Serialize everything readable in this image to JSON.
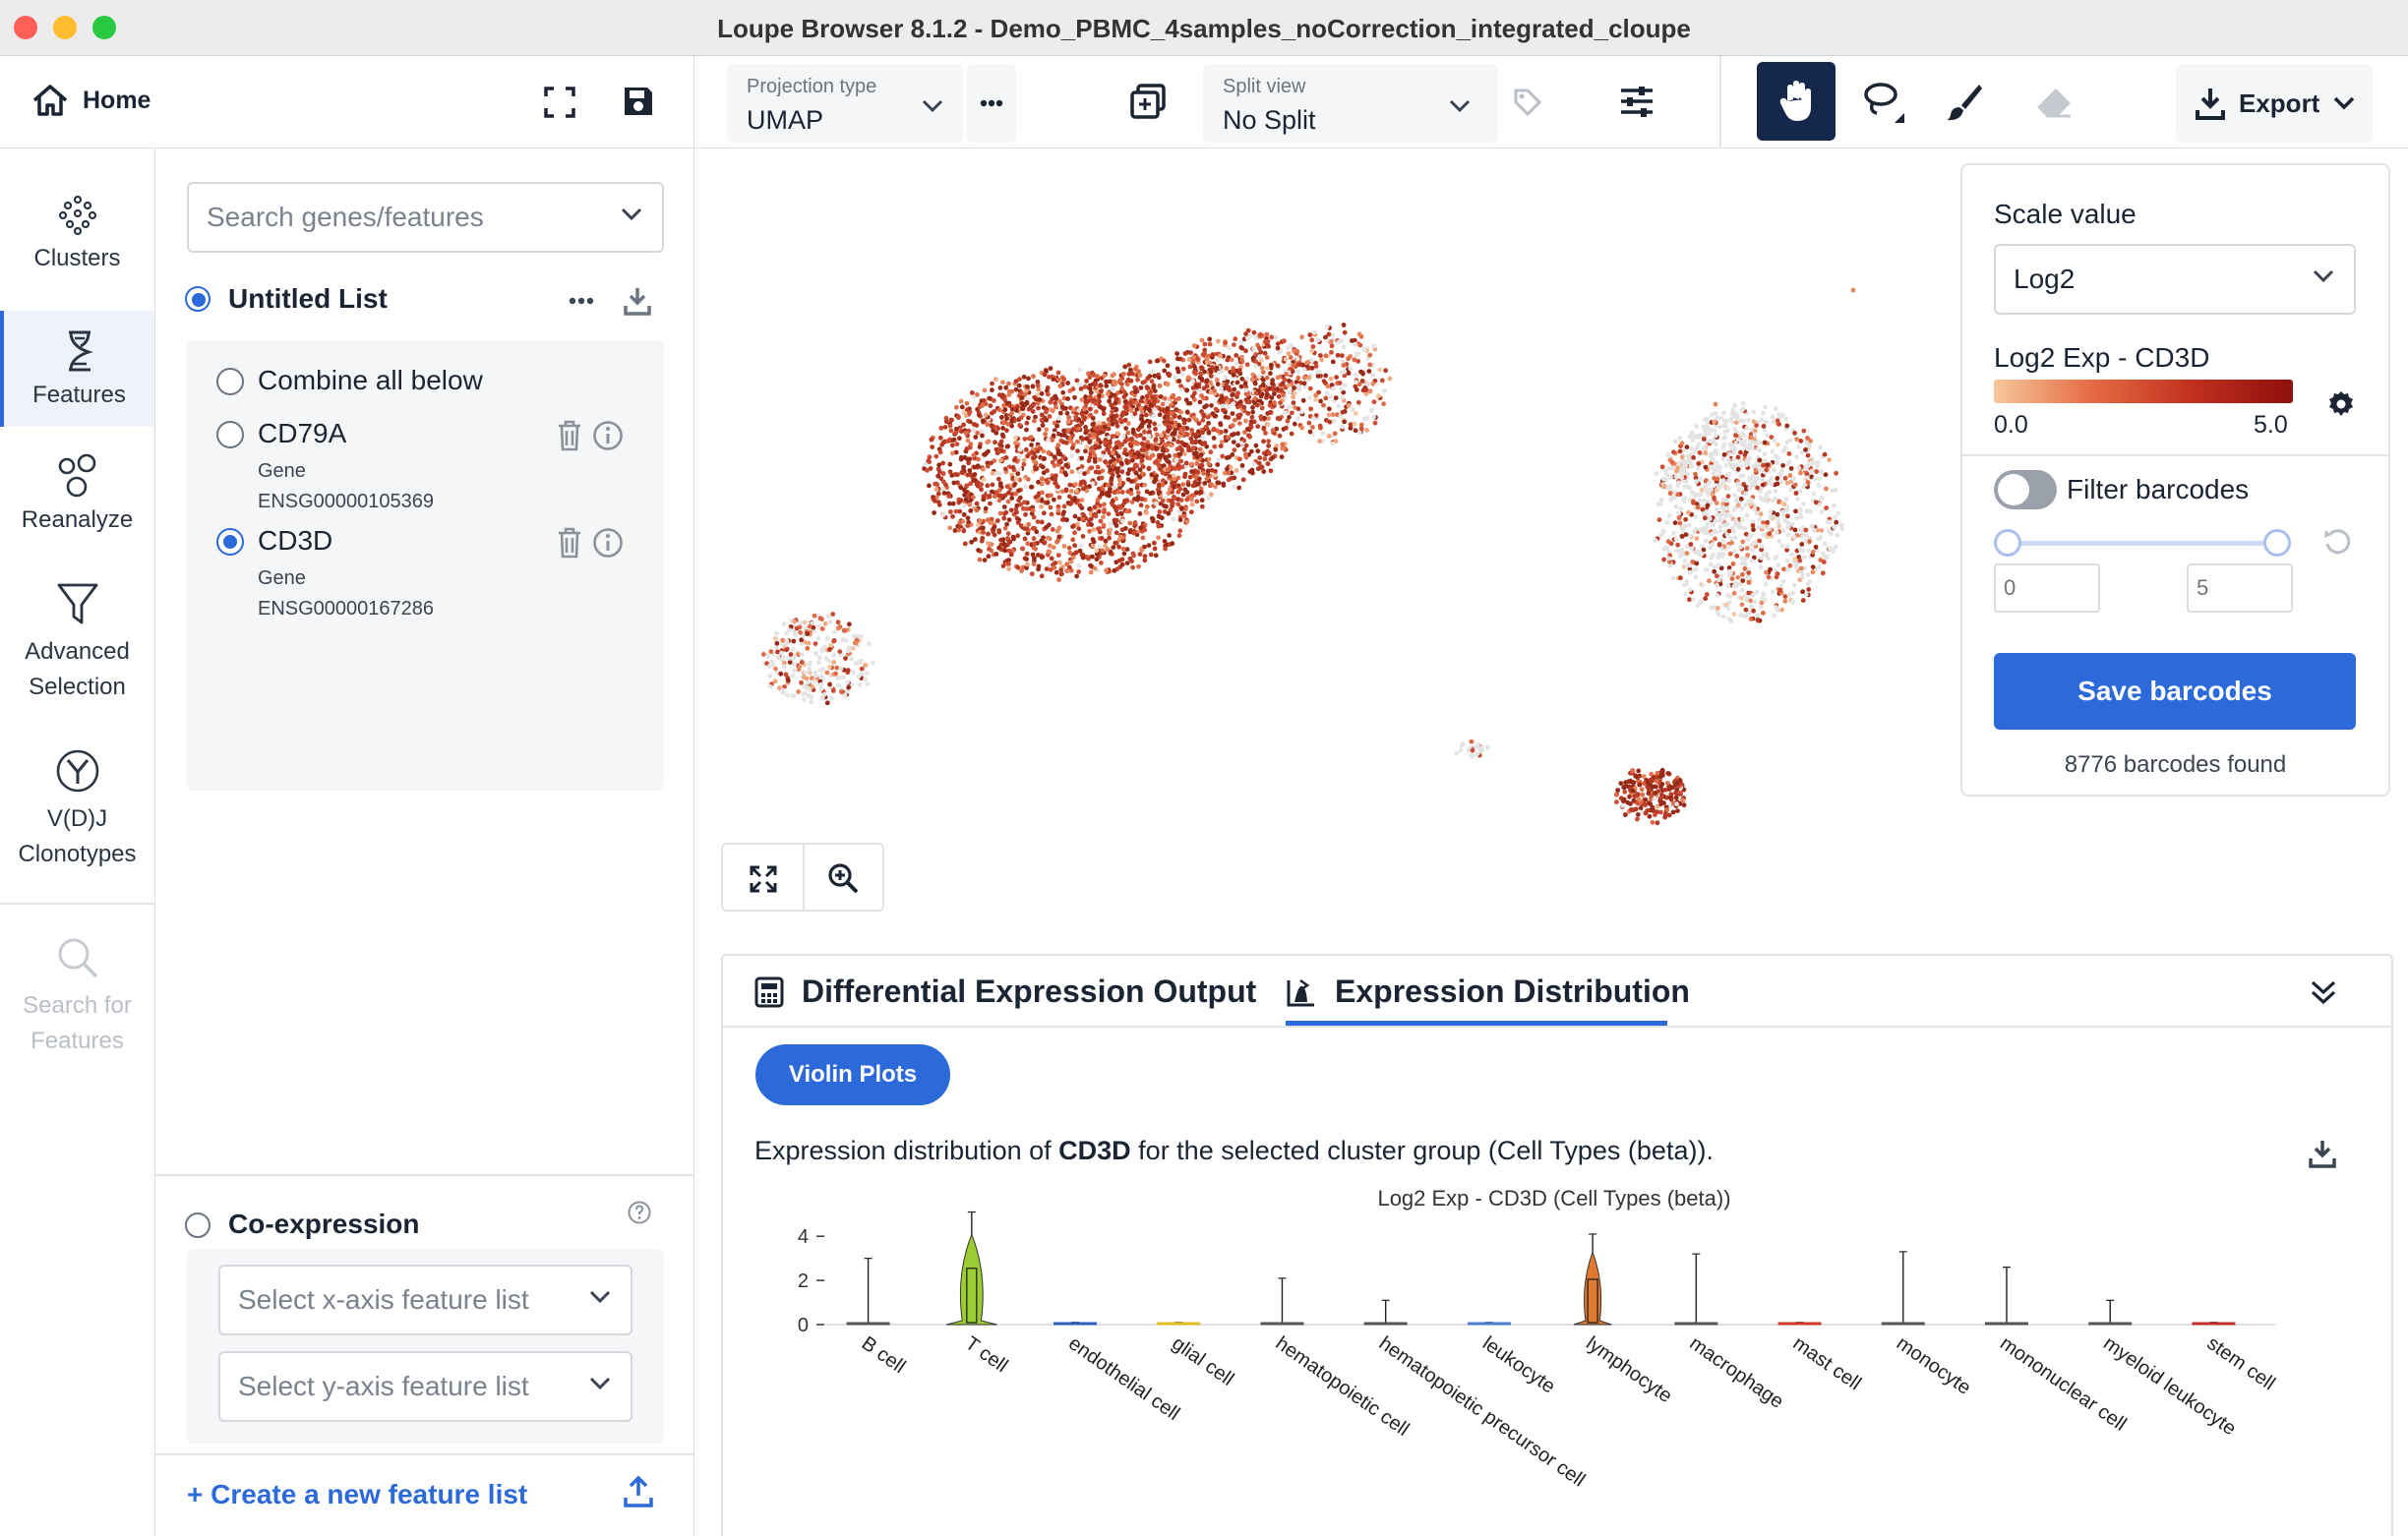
{
  "window": {
    "title": "Loupe Browser 8.1.2 - Demo_PBMC_4samples_noCorrection_integrated_cloupe"
  },
  "home": {
    "label": "Home"
  },
  "toolbar": {
    "projection": {
      "label": "Projection type",
      "value": "UMAP"
    },
    "split": {
      "label": "Split view",
      "value": "No Split"
    },
    "export_label": "Export"
  },
  "sidebar": {
    "items": [
      {
        "id": "clusters",
        "label": "Clusters"
      },
      {
        "id": "features",
        "label": "Features"
      },
      {
        "id": "reanalyze",
        "label": "Reanalyze"
      },
      {
        "id": "advanced",
        "label": "Advanced Selection"
      },
      {
        "id": "vdj",
        "label": "V(D)J Clonotypes"
      },
      {
        "id": "search",
        "label": "Search for Features"
      }
    ]
  },
  "features_panel": {
    "search_placeholder": "Search genes/features",
    "list_title": "Untitled List",
    "combine_label": "Combine all below",
    "genes": [
      {
        "name": "CD79A",
        "type": "Gene",
        "id": "ENSG00000105369",
        "selected": false
      },
      {
        "name": "CD3D",
        "type": "Gene",
        "id": "ENSG00000167286",
        "selected": true
      }
    ],
    "coexpression": {
      "title": "Co-expression",
      "x_placeholder": "Select x-axis feature list",
      "y_placeholder": "Select y-axis feature list"
    },
    "create_label": "+ Create a new feature list"
  },
  "scale_card": {
    "title": "Scale value",
    "scale_value": "Log2",
    "legend_title": "Log2 Exp - CD3D",
    "min_label": "0.0",
    "max_label": "5.0",
    "filter_label": "Filter barcodes",
    "range_min_placeholder": "0",
    "range_max_placeholder": "5",
    "save_label": "Save barcodes",
    "found_label": "8776 barcodes found",
    "gradient_start": "#f6c79b",
    "gradient_end": "#8e0f0b"
  },
  "bottom_panel": {
    "tab_de": "Differential Expression Output",
    "tab_ed": "Expression Distribution",
    "violin_button": "Violin Plots",
    "description_prefix": "Expression distribution of ",
    "description_gene": "CD3D",
    "description_suffix": " for the selected cluster group (Cell Types (beta)).",
    "accent": "#2c6ad9"
  },
  "chart_data": {
    "type": "violin",
    "title": "Log2 Exp - CD3D (Cell Types (beta))",
    "xlabel": "",
    "ylabel": "",
    "ylim": [
      0,
      5
    ],
    "yticks": [
      0,
      2,
      4
    ],
    "categories": [
      "B cell",
      "T cell",
      "endothelial cell",
      "glial cell",
      "hematopoietic cell",
      "hematopoietic precursor cell",
      "leukocyte",
      "lymphocyte",
      "macrophage",
      "mast cell",
      "monocyte",
      "mononuclear cell",
      "myeloid leukocyte",
      "stem cell"
    ],
    "max_values": [
      3.0,
      5.1,
      0.1,
      0.1,
      2.1,
      1.1,
      0.1,
      4.1,
      3.2,
      0.1,
      3.3,
      2.6,
      1.1,
      0.1
    ],
    "colors": [
      "#555555",
      "#9acd32",
      "#2f5fbf",
      "#e0c020",
      "#555555",
      "#555555",
      "#4a7fd0",
      "#e07a30",
      "#555555",
      "#d03a2a",
      "#555555",
      "#555555",
      "#555555",
      "#c0302a"
    ]
  }
}
